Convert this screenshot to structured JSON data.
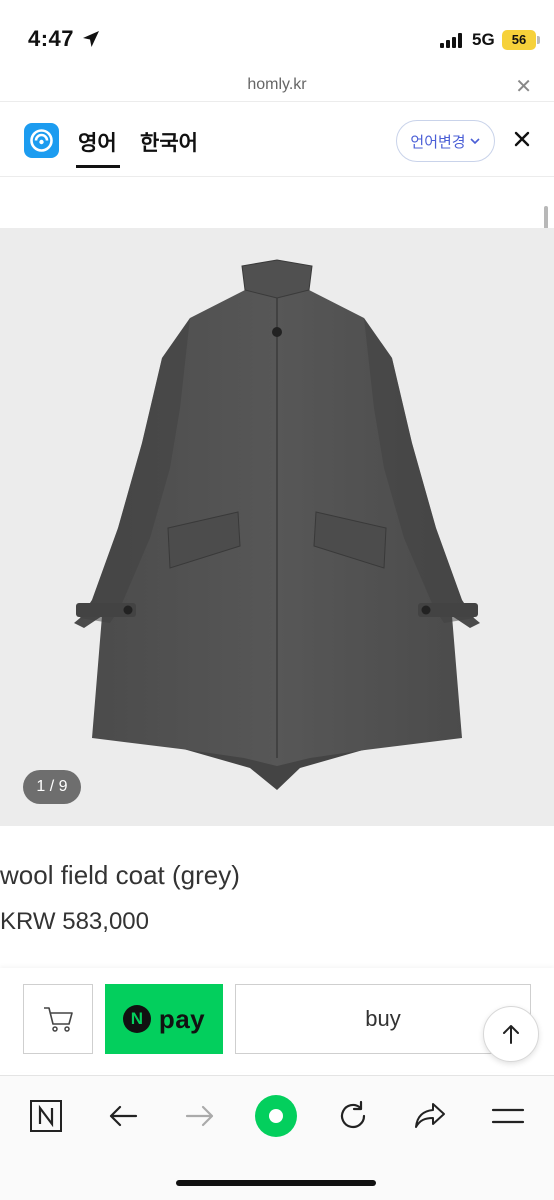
{
  "status_bar": {
    "time": "4:47",
    "network": "5G",
    "battery": "56"
  },
  "url_bar": {
    "domain": "homly.kr",
    "close_symbol": "✕"
  },
  "translate_bar": {
    "tabs": [
      {
        "label": "영어",
        "active": true
      },
      {
        "label": "한국어",
        "active": false
      }
    ],
    "change_language_label": "언어변경",
    "accent_color": "#4b5fd6"
  },
  "product": {
    "image_counter": "1 / 9",
    "name": "wool field coat (grey)",
    "price": "KRW 583,000"
  },
  "purchase_bar": {
    "npay_logo_letter": "N",
    "npay_label": "pay",
    "buy_label": "buy",
    "npay_color": "#03cf5d"
  },
  "browser_toolbar": {
    "icons": [
      "naver-n-icon",
      "back-arrow-icon",
      "forward-arrow-icon",
      "green-dot-icon",
      "reload-icon",
      "share-icon",
      "menu-icon"
    ]
  }
}
